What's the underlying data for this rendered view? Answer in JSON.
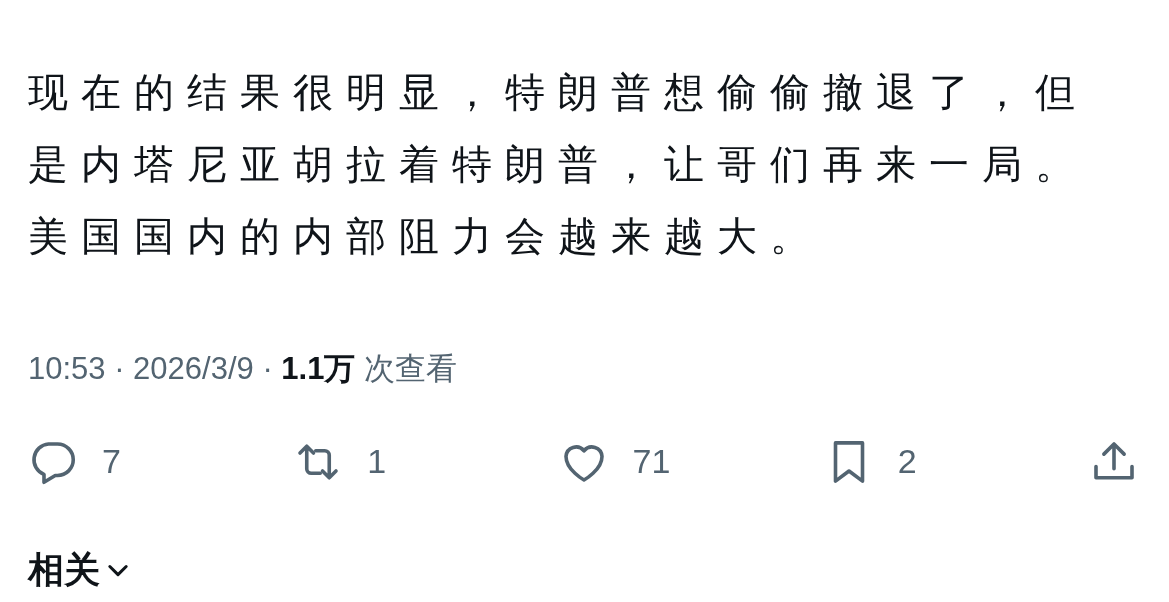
{
  "post": {
    "text": "现在的结果很明显，特朗普想偷偷撤退了，但是内塔尼亚胡拉着特朗普，让哥们再来一局。美国国内的内部阻力会越来越大。"
  },
  "meta": "10:53 · 2026/3/9 · **1.1万** 次查看",
  "actions": [
    {
      "kind": "reply",
      "count": "7"
    },
    {
      "kind": "repost",
      "count": "1"
    },
    {
      "kind": "like",
      "count": "71"
    },
    {
      "kind": "bookmark",
      "count": "2"
    },
    {
      "kind": "share"
    }
  ],
  "related": {
    "label": "相关"
  }
}
